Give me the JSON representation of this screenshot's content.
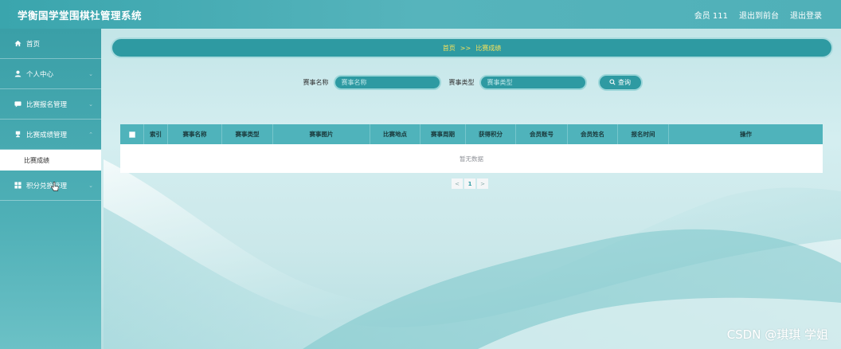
{
  "header": {
    "app_title": "学衡国学堂围棋社管理系统",
    "member_label": "会员 111",
    "front_link": "退出到前台",
    "logout_link": "退出登录"
  },
  "sidebar": {
    "items": [
      {
        "label": "首页",
        "icon": "home-icon"
      },
      {
        "label": "个人中心",
        "icon": "user-icon"
      },
      {
        "label": "比赛报名管理",
        "icon": "comment-icon"
      },
      {
        "label": "比赛成绩管理",
        "icon": "trophy-icon"
      },
      {
        "label": "积分兑换管理",
        "icon": "grid-icon"
      }
    ],
    "submenu": {
      "label": "比赛成绩"
    }
  },
  "breadcrumb": {
    "home": "首页",
    "separator": ">>",
    "current": "比赛成绩"
  },
  "search": {
    "name_label": "赛事名称",
    "name_placeholder": "赛事名称",
    "type_label": "赛事类型",
    "type_placeholder": "赛事类型",
    "query_label": "查询"
  },
  "table": {
    "columns": [
      "索引",
      "赛事名称",
      "赛事类型",
      "赛事图片",
      "比赛地点",
      "赛事周期",
      "获得积分",
      "会员账号",
      "会员姓名",
      "报名时间",
      "操作"
    ],
    "empty_text": "暂无数据"
  },
  "pagination": {
    "prev": "<",
    "current_page": "1",
    "next": ">"
  },
  "watermark": "CSDN @琪琪 学姐",
  "colors": {
    "accent": "#2e9aa2",
    "header": "#4fb3bb",
    "breadcrumb_text": "#f5e15a"
  }
}
